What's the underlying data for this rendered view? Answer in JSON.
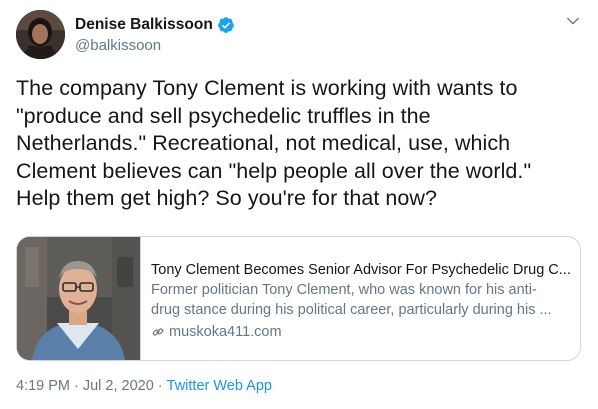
{
  "author": {
    "display_name": "Denise Balkissoon",
    "handle": "@balkissoon",
    "verified": true,
    "avatar_icon": "avatar-photo"
  },
  "tweet": {
    "text": "The company Tony Clement is working with wants to\n\"produce and sell psychedelic truffles in the\nNetherlands.\" Recreational, not medical, use, which\nClement believes can \"help people all over the world.\"\nHelp them get high? So you're for that now?"
  },
  "card": {
    "title": "Tony Clement Becomes Senior Advisor For Psychedelic Drug C...",
    "description": "Former politician Tony Clement, who was known for his anti-\ndrug stance during his political career, particularly during his ...",
    "domain": "muskoka411.com",
    "image_icon": "article-thumbnail"
  },
  "meta": {
    "time": "4:19 PM",
    "separator": "·",
    "date": "Jul 2, 2020",
    "source": "Twitter Web App"
  },
  "colors": {
    "text_primary": "#14171a",
    "text_secondary": "#657786",
    "link": "#1b95e0",
    "verified": "#1da1f2",
    "border": "#ccd6dd"
  }
}
